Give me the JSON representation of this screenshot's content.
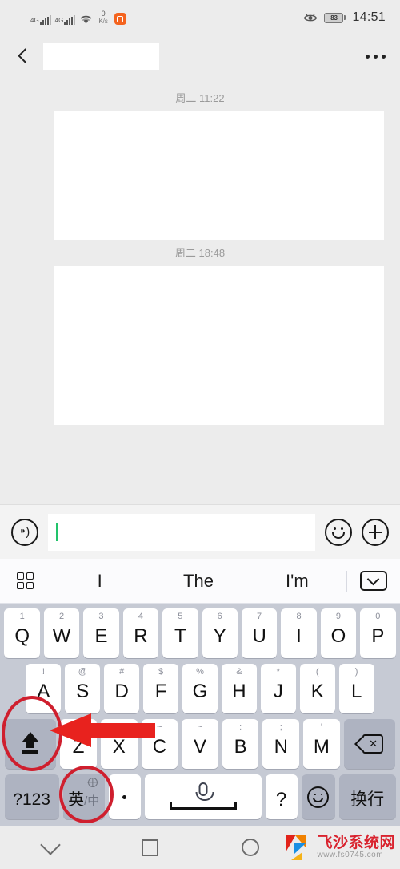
{
  "status_bar": {
    "network_label_1": "4G",
    "network_label_2": "4G",
    "wifi_icon": "wifi-icon",
    "data_speed_value": "0",
    "data_speed_unit": "K/s",
    "app_badge_icon": "orange-app-icon",
    "eye_icon": "eye-comfort-icon",
    "battery_percent": "83",
    "time": "14:51"
  },
  "nav_header": {
    "back_icon": "back-chevron-icon",
    "title": "",
    "more_icon": "more-options-icon"
  },
  "chat": {
    "messages": [
      {
        "timestamp": "周二 11:22",
        "body": ""
      },
      {
        "timestamp": "周二 18:48",
        "body": ""
      }
    ]
  },
  "input_bar": {
    "voice_icon": "voice-input-icon",
    "field_value": "",
    "field_placeholder": "",
    "emoji_icon": "emoji-smiley-icon",
    "add_icon": "plus-circle-icon"
  },
  "suggestion_row": {
    "grid_icon": "keyboard-grid-icon",
    "suggestions": [
      "I",
      "The",
      "I'm"
    ],
    "collapse_icon": "collapse-keyboard-icon"
  },
  "keyboard": {
    "row1": [
      {
        "hint": "1",
        "label": "Q"
      },
      {
        "hint": "2",
        "label": "W"
      },
      {
        "hint": "3",
        "label": "E"
      },
      {
        "hint": "4",
        "label": "R"
      },
      {
        "hint": "5",
        "label": "T"
      },
      {
        "hint": "6",
        "label": "Y"
      },
      {
        "hint": "7",
        "label": "U"
      },
      {
        "hint": "8",
        "label": "I"
      },
      {
        "hint": "9",
        "label": "O"
      },
      {
        "hint": "0",
        "label": "P"
      }
    ],
    "row2": [
      {
        "hint": "!",
        "label": "A"
      },
      {
        "hint": "@",
        "label": "S"
      },
      {
        "hint": "#",
        "label": "D"
      },
      {
        "hint": "$",
        "label": "F"
      },
      {
        "hint": "%",
        "label": "G"
      },
      {
        "hint": "&",
        "label": "H"
      },
      {
        "hint": "*",
        "label": "J"
      },
      {
        "hint": "(",
        "label": "K"
      },
      {
        "hint": ")",
        "label": "L"
      }
    ],
    "row3": [
      {
        "hint": "-",
        "label": "Z"
      },
      {
        "hint": "/",
        "label": "X"
      },
      {
        "hint": "~",
        "label": "C"
      },
      {
        "hint": "~",
        "label": "V"
      },
      {
        "hint": ":",
        "label": "B"
      },
      {
        "hint": ";",
        "label": "N"
      },
      {
        "hint": "'",
        "label": "M"
      }
    ],
    "shift_key": "shift-key",
    "backspace_key": "backspace-key",
    "bottom": {
      "symbols_label": "?123",
      "lang_label": "英",
      "lang_sub": "/中",
      "lang_globe_icon": "globe-icon",
      "period_label": ".",
      "space_icon": "microphone-icon",
      "question_label": "?",
      "emoji_label": "emoji-key-icon",
      "enter_label": "换行"
    }
  },
  "annotations": {
    "highlight_color": "#cf1f2e",
    "arrow_color": "#e8221e",
    "circled_shift": "shift-key-highlight",
    "circled_lang": "language-key-highlight",
    "arrow": "pointer-arrow-to-shift"
  },
  "system_nav": {
    "back_down_icon": "hide-keyboard-icon",
    "recents_icon": "recent-apps-icon",
    "home_icon": "home-icon"
  },
  "watermark": {
    "site_name": "飞沙系统网",
    "url": "www.fs0745.com"
  }
}
